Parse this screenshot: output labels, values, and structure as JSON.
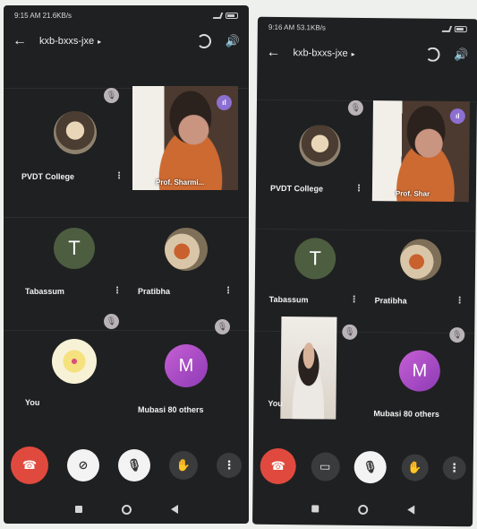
{
  "screens": [
    {
      "status_time": "9:15 AM",
      "status_speed": "21.6KB/s",
      "meeting_code": "kxb-bxxs-jxe",
      "participants": {
        "college": "PVDT College",
        "speaker": "Prof. Sharmi...",
        "tabassum": "Tabassum",
        "tabassum_initial": "T",
        "pratibha": "Pratibha",
        "you": "You",
        "mubasi": "Mubasi",
        "mubasi_initial": "M",
        "others": "80 others"
      }
    },
    {
      "status_time": "9:16 AM",
      "status_speed": "53.1KB/s",
      "meeting_code": "kxb-bxxs-jxe",
      "participants": {
        "college": "PVDT College",
        "speaker": "Prof. Shar",
        "tabassum": "Tabassum",
        "tabassum_initial": "T",
        "pratibha": "Pratibha",
        "you": "You",
        "mubasi": "Mubasi",
        "mubasi_initial": "M",
        "others": "80 others"
      }
    }
  ],
  "icons": {
    "back": "back-arrow-icon",
    "flip": "flip-camera-icon",
    "speaker": "speaker-icon",
    "mic_off": "mic-off-icon",
    "more": "more-vert-icon",
    "hangup": "hangup-icon",
    "camera": "camera-icon",
    "hand": "raise-hand-icon"
  },
  "colors": {
    "background": "#1f2021",
    "hangup": "#e04a3e",
    "mute_badge": "#b9b3b8",
    "avatar_m": "#a04cc8"
  }
}
